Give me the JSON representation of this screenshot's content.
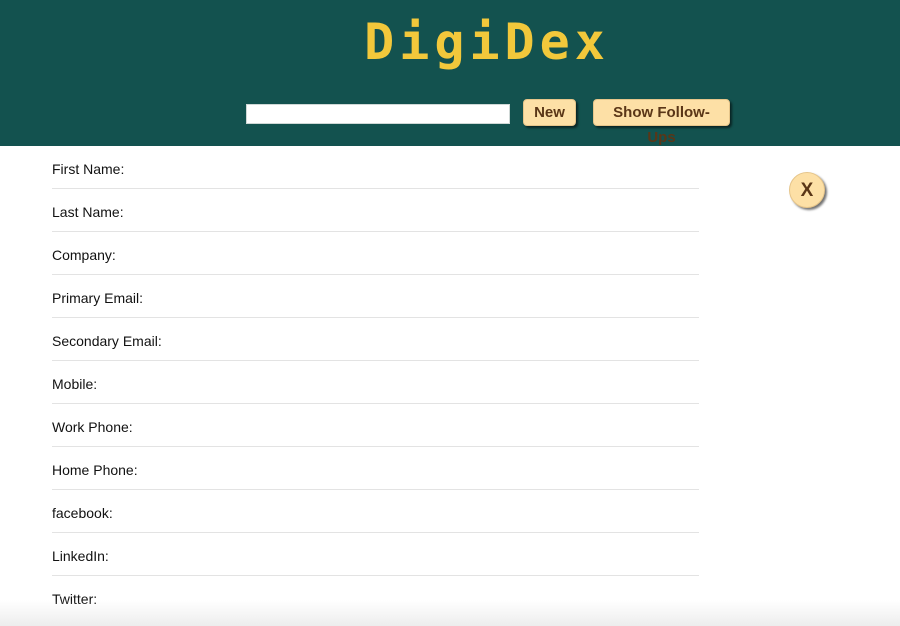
{
  "header": {
    "logo_text": "DigiDex",
    "search": {
      "value": "",
      "placeholder": ""
    },
    "new_button_label": "New",
    "follow_ups_button_label": "Show Follow-Ups"
  },
  "form": {
    "fields": [
      {
        "label": "First Name:"
      },
      {
        "label": "Last Name:"
      },
      {
        "label": "Company:"
      },
      {
        "label": "Primary Email:"
      },
      {
        "label": "Secondary Email:"
      },
      {
        "label": "Mobile:"
      },
      {
        "label": "Work Phone:"
      },
      {
        "label": "Home Phone:"
      },
      {
        "label": "facebook:"
      },
      {
        "label": "LinkedIn:"
      },
      {
        "label": "Twitter:"
      }
    ]
  },
  "close_button_label": "X",
  "colors": {
    "header_bg": "#13524f",
    "logo": "#f2c83b",
    "button_bg": "#fde0a6",
    "button_text": "#5a3617"
  }
}
